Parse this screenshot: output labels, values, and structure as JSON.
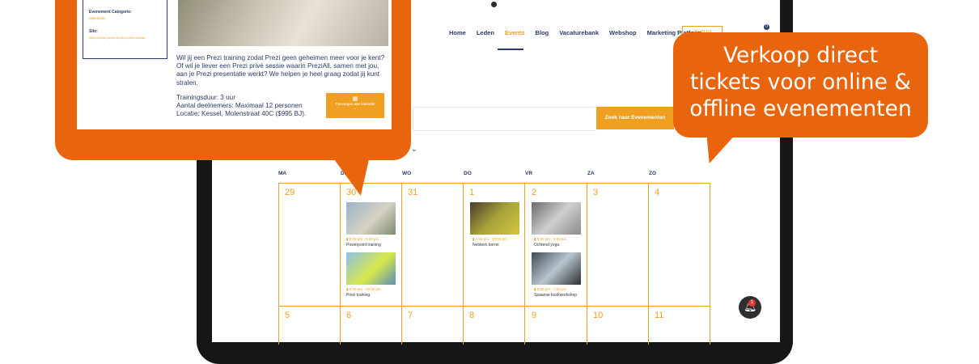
{
  "nav": {
    "items": [
      "Home",
      "Leden",
      "Events",
      "Blog",
      "Vacaturebank",
      "Webshop",
      "Marketing Platform"
    ],
    "active": "Events",
    "cta_label": "Word lid",
    "cart_count": "0"
  },
  "search": {
    "button_label": "Zoek naar Evenementen",
    "placeholder": ""
  },
  "calendar": {
    "weekdays": [
      "MA",
      "DI",
      "WO",
      "DO",
      "VR",
      "ZA",
      "ZO"
    ],
    "week1": [
      "29",
      "30",
      "31",
      "1",
      "2",
      "3",
      "4"
    ],
    "week2": [
      "5",
      "6",
      "7",
      "8",
      "9",
      "10",
      "11"
    ],
    "events": [
      {
        "time": "9:00 am - 5:00 pm",
        "title": "Powerpoint training"
      },
      {
        "time": "9:00 am - 12:00 pm",
        "title": "Prezi training"
      },
      {
        "time": "7:00 pm - 10:00 pm",
        "title": "Netwerk borrel"
      },
      {
        "time": "8:00 am - 9:00 am",
        "title": "Ochtend yoga"
      },
      {
        "time": "5:00 pm - 7:00 pm",
        "title": "Spaanse kookworkshop"
      }
    ]
  },
  "event_card": {
    "category_label": "Evenement Categorie:",
    "category_value": "Openbaar",
    "site_label": "Site:",
    "site_value": "https://www.prezill.nl/prezi-prive-sessie/",
    "description": "Wil jij een Prezi training zodat Prezi geen geheimen meer voor je kent? Of wil je liever een Prezi privé sessie waarin PreziAll, samen met jou, aan je Prezi presentatie werkt? We helpen je heel graag zodat jij kunt stralen.",
    "duration": "Trainingsduur: 3 uur",
    "participants": "Aantal deelnemers: Maximaal 12 personen",
    "location": "Locatie: Kessel, Molenstraat 40C ($995 BJ).",
    "calendar_button": "Toevoegen aan kalender"
  },
  "callout": {
    "line1": "Verkoop direct",
    "line2": "tickets voor online &",
    "line3": "offline evenementen"
  },
  "notification": {
    "count": "1"
  },
  "colors": {
    "accent": "#f0a020",
    "callout": "#e8650e",
    "navy": "#2b3a6b"
  }
}
